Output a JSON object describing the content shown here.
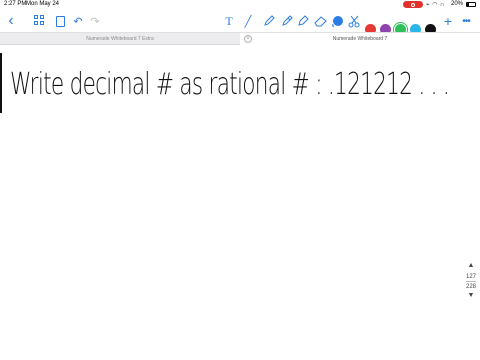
{
  "status_bar": {
    "time": "2:27 PM",
    "date": "Mon May 24",
    "battery": "20%",
    "record_color": "#e0312b"
  },
  "toolbar": {
    "accent": "#2a7de1",
    "colors": [
      "#e53935",
      "#8e44ad",
      "#2fbf5a",
      "#29b6e8",
      "#111111"
    ],
    "selected_color_index": 2,
    "add_label": "+",
    "more_label": "•••"
  },
  "tabs": [
    {
      "title": "Numerade Whiteboard 7 Extra"
    },
    {
      "title": "Numerade Whiteboard 7"
    }
  ],
  "canvas": {
    "handwriting": "Write decimal # as rational # : .121212 . . ."
  },
  "page_scroller": {
    "current_page": "127",
    "total_pages": "228"
  }
}
